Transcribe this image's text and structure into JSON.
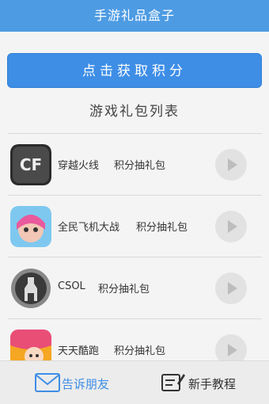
{
  "app": {
    "title": "手游礼品盒子"
  },
  "actions": {
    "earn_points_label": "点击获取积分"
  },
  "list": {
    "heading": "游戏礼包列表",
    "items": [
      {
        "game": "穿越火线",
        "gift": "积分抽礼包",
        "icon": "crossfire-game-icon"
      },
      {
        "game": "全民飞机大战",
        "gift": "积分抽礼包",
        "icon": "plane-war-game-icon"
      },
      {
        "game": "CSOL",
        "gift": "积分抽礼包",
        "icon": "csol-game-icon"
      },
      {
        "game": "天天酷跑",
        "gift": "积分抽礼包",
        "icon": "everyday-parkour-game-icon"
      }
    ]
  },
  "bottom_bar": {
    "tell_friends_label": "告诉朋友",
    "tutorial_label": "新手教程"
  },
  "colors": {
    "accent": "#3e8ee6",
    "title_bar": "#4d9be3"
  }
}
